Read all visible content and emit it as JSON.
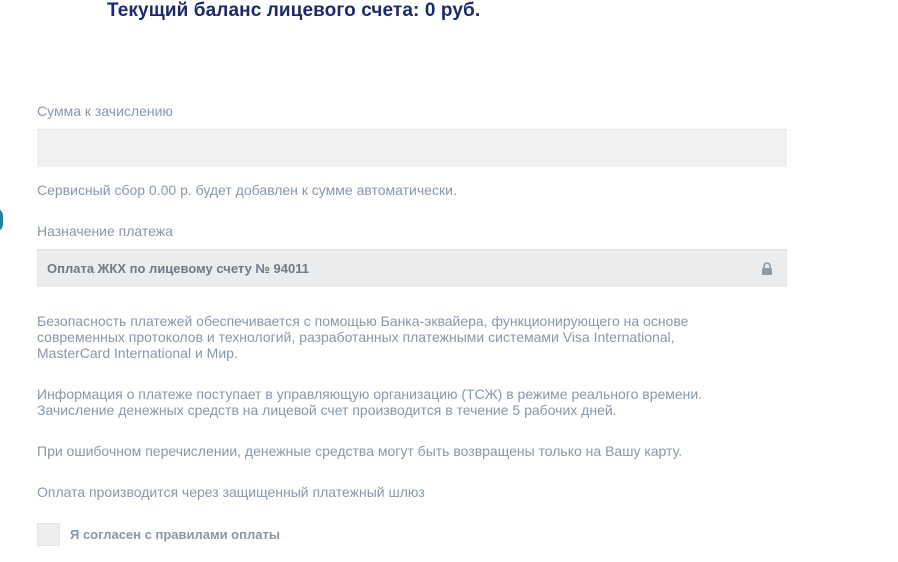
{
  "balance": {
    "title": "Текущий баланс лицевого счета: 0 руб."
  },
  "amount": {
    "label": "Сумма к зачислению",
    "value": "",
    "placeholder": ""
  },
  "service_fee_note": "Сервисный сбор 0.00 р. будет добавлен к сумме автоматически.",
  "purpose": {
    "label": "Назначение платежа",
    "value": "Оплата ЖКХ по лицевому счету № 94011",
    "locked_icon": "lock-icon"
  },
  "info": {
    "security_line1": "Безопасность платежей обеспечивается с помощью Банка-эквайера, функционирующего на основе",
    "security_line2": "современных протоколов и технологий, разработанных платежными системами Visa International,",
    "security_line3": "MasterCard International и Мир.",
    "realtime_line1": "Информация о платеже поступает в управляющую организацию (ТСЖ) в режиме реального времени.",
    "realtime_line2": "Зачисление денежных средств на лицевой счет производится в течение 5 рабочих дней.",
    "refund": "При ошибочном перечислении, денежные средства могут быть возвращены только на Вашу карту.",
    "gateway": "Оплата производится через защищенный платежный шлюз"
  },
  "agreement": {
    "label": "Я согласен с правилами оплаты",
    "checked": false
  },
  "colors": {
    "title": "#1a2a6c",
    "muted_text": "#8a97a8",
    "field_bg": "#eff1f2",
    "accent_marker": "#0d8aa8"
  }
}
